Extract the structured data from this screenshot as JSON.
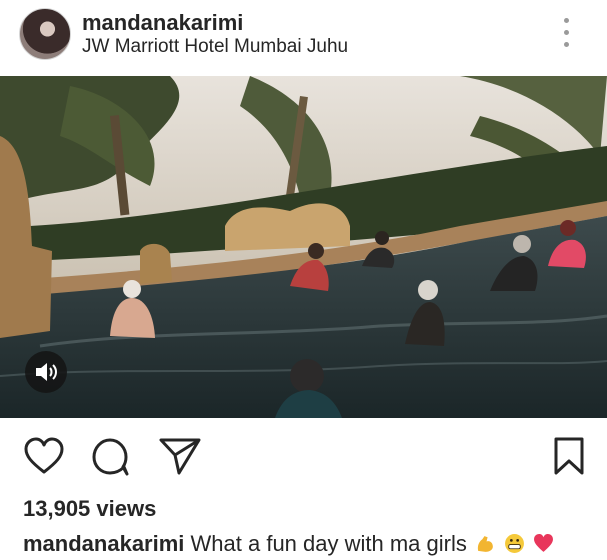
{
  "post": {
    "username": "mandanakarimi",
    "location": "JW Marriott Hotel Mumbai Juhu",
    "views": "13,905 views",
    "caption_user": "mandanakarimi",
    "caption_text": "What a fun day with ma girls"
  },
  "icons": {
    "more": "more-options-icon",
    "sound": "sound-on-icon",
    "like": "heart-icon",
    "comment": "comment-icon",
    "share": "send-icon",
    "save": "bookmark-icon",
    "emoji": [
      "flexed-biceps-emoji",
      "grimacing-face-emoji",
      "red-heart-emoji"
    ]
  }
}
